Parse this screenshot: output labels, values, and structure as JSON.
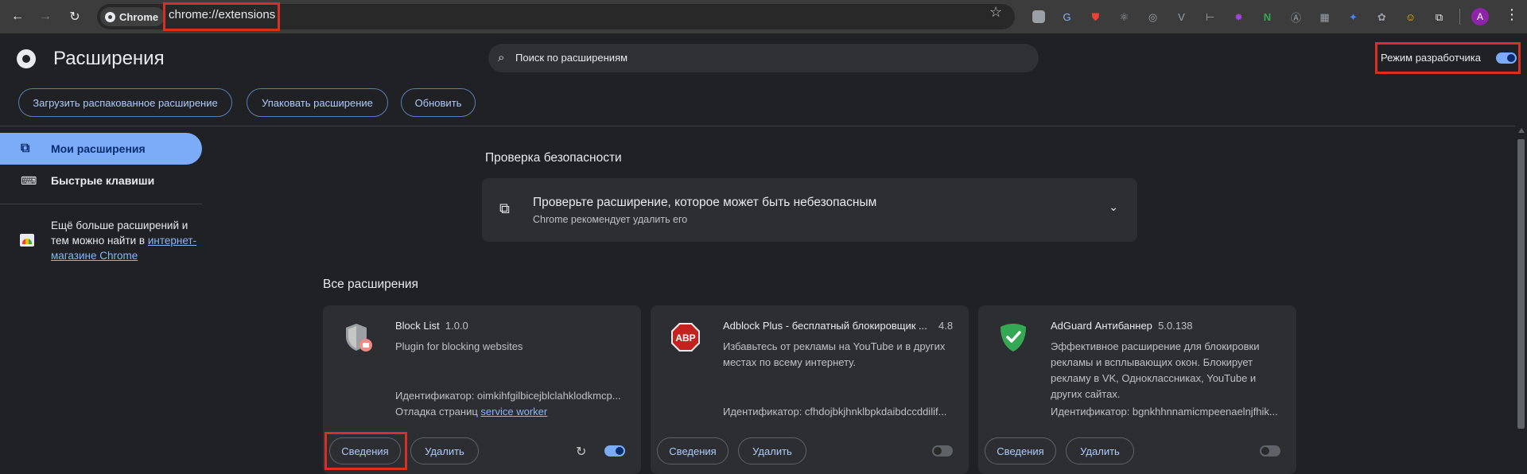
{
  "browser": {
    "chip_label": "Chrome",
    "url": "chrome://extensions",
    "avatar_letter": "A",
    "toolbar_icons": [
      "reader-icon",
      "translate-icon",
      "ublock-icon",
      "react-icon",
      "circle-icon",
      "v-icon",
      "bracket-icon",
      "puzzle-purple-icon",
      "notion-n-icon",
      "a-circle-icon",
      "grid-icon",
      "spark-icon",
      "gray-icon",
      "face-icon",
      "extensions-icon"
    ]
  },
  "header": {
    "title": "Расширения",
    "search_placeholder": "Поиск по расширениям",
    "dev_mode_label": "Режим разработчика",
    "dev_mode_on": true
  },
  "actions": {
    "load_unpacked": "Загрузить распакованное расширение",
    "pack": "Упаковать расширение",
    "update": "Обновить"
  },
  "sidebar": {
    "items": [
      {
        "label": "Мои расширения",
        "active": true
      },
      {
        "label": "Быстрые клавиши",
        "active": false
      }
    ],
    "store_text_1": "Ещё больше расширений и тем можно найти в",
    "store_link": "интернет-магазине Chrome"
  },
  "safety": {
    "title": "Проверка безопасности",
    "card_title": "Проверьте расширение, которое может быть небезопасным",
    "card_subtitle": "Chrome рекомендует удалить его"
  },
  "all_title": "Все расширения",
  "extensions": [
    {
      "name": "Block List",
      "version": "1.0.0",
      "description": "Plugin for blocking websites",
      "id": "Идентификатор: oimkihfgilbicejblclahklodkmcp...",
      "debug_label": "Отладка страниц",
      "debug_link": "service worker",
      "details": "Сведения",
      "remove": "Удалить",
      "enabled": true
    },
    {
      "name": "Adblock Plus - бесплатный блокировщик ...",
      "version": "4.8",
      "description": "Избавьтесь от рекламы на YouTube и в других местах по всему интернету.",
      "id": "Идентификатор: cfhdojbkjhnklbpkdaibdccddilif...",
      "logo_text": "ABP",
      "details": "Сведения",
      "remove": "Удалить",
      "enabled": false
    },
    {
      "name": "AdGuard Антибаннер",
      "version": "5.0.138",
      "description": "Эффективное расширение для блокировки рекламы и всплывающих окон. Блокирует рекламу в VK, Одноклассниках, YouTube и других сайтах.",
      "id": "Идентификатор: bgnkhhnnamicmpeenaelnjfhik...",
      "details": "Сведения",
      "remove": "Удалить",
      "enabled": false
    }
  ],
  "colors": {
    "accent": "#7cacf8",
    "highlight": "#d93025",
    "card": "#2d2e31"
  }
}
